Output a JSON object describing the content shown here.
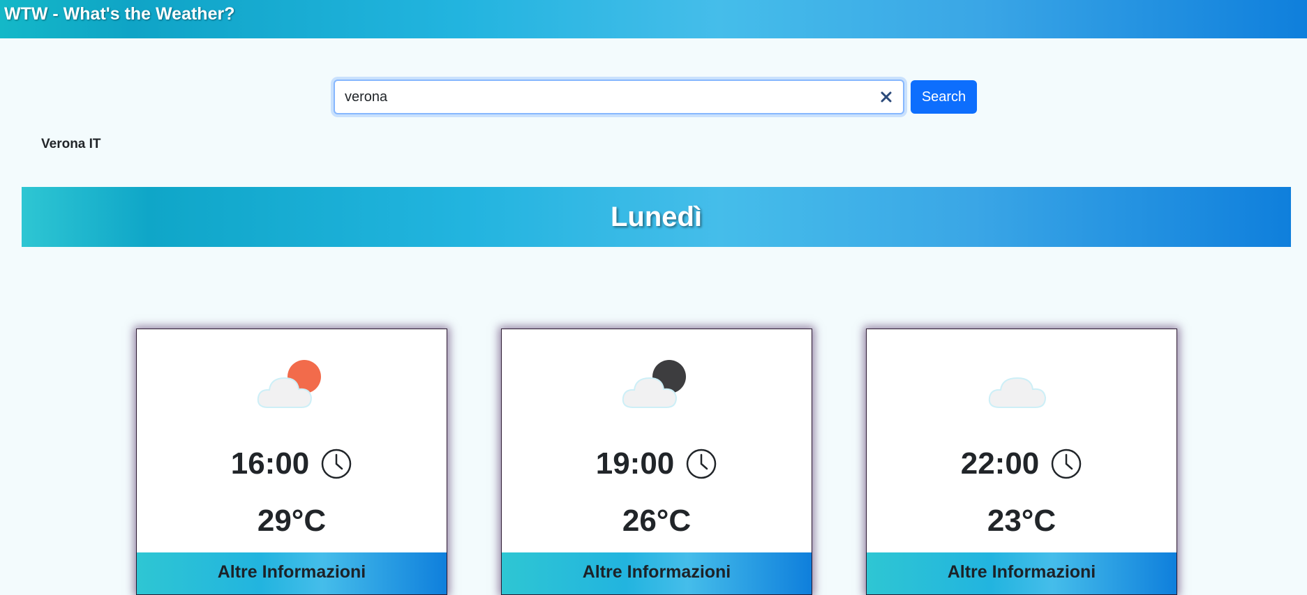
{
  "header": {
    "title": "WTW - What's the Weather?"
  },
  "search": {
    "value": "verona",
    "search_label": "Search"
  },
  "location": "Verona IT",
  "day": "Lunedì",
  "forecasts": [
    {
      "icon": "partly-cloudy-day-icon",
      "time": "16:00",
      "temp": "29°C",
      "more_label": "Altre Informazioni"
    },
    {
      "icon": "partly-cloudy-night-icon",
      "time": "19:00",
      "temp": "26°C",
      "more_label": "Altre Informazioni"
    },
    {
      "icon": "cloud-icon",
      "time": "22:00",
      "temp": "23°C",
      "more_label": "Altre Informazioni"
    }
  ],
  "colors": {
    "accent": "#0d6efd",
    "sun": "#f26b4b",
    "moon": "#3d3d3f"
  }
}
